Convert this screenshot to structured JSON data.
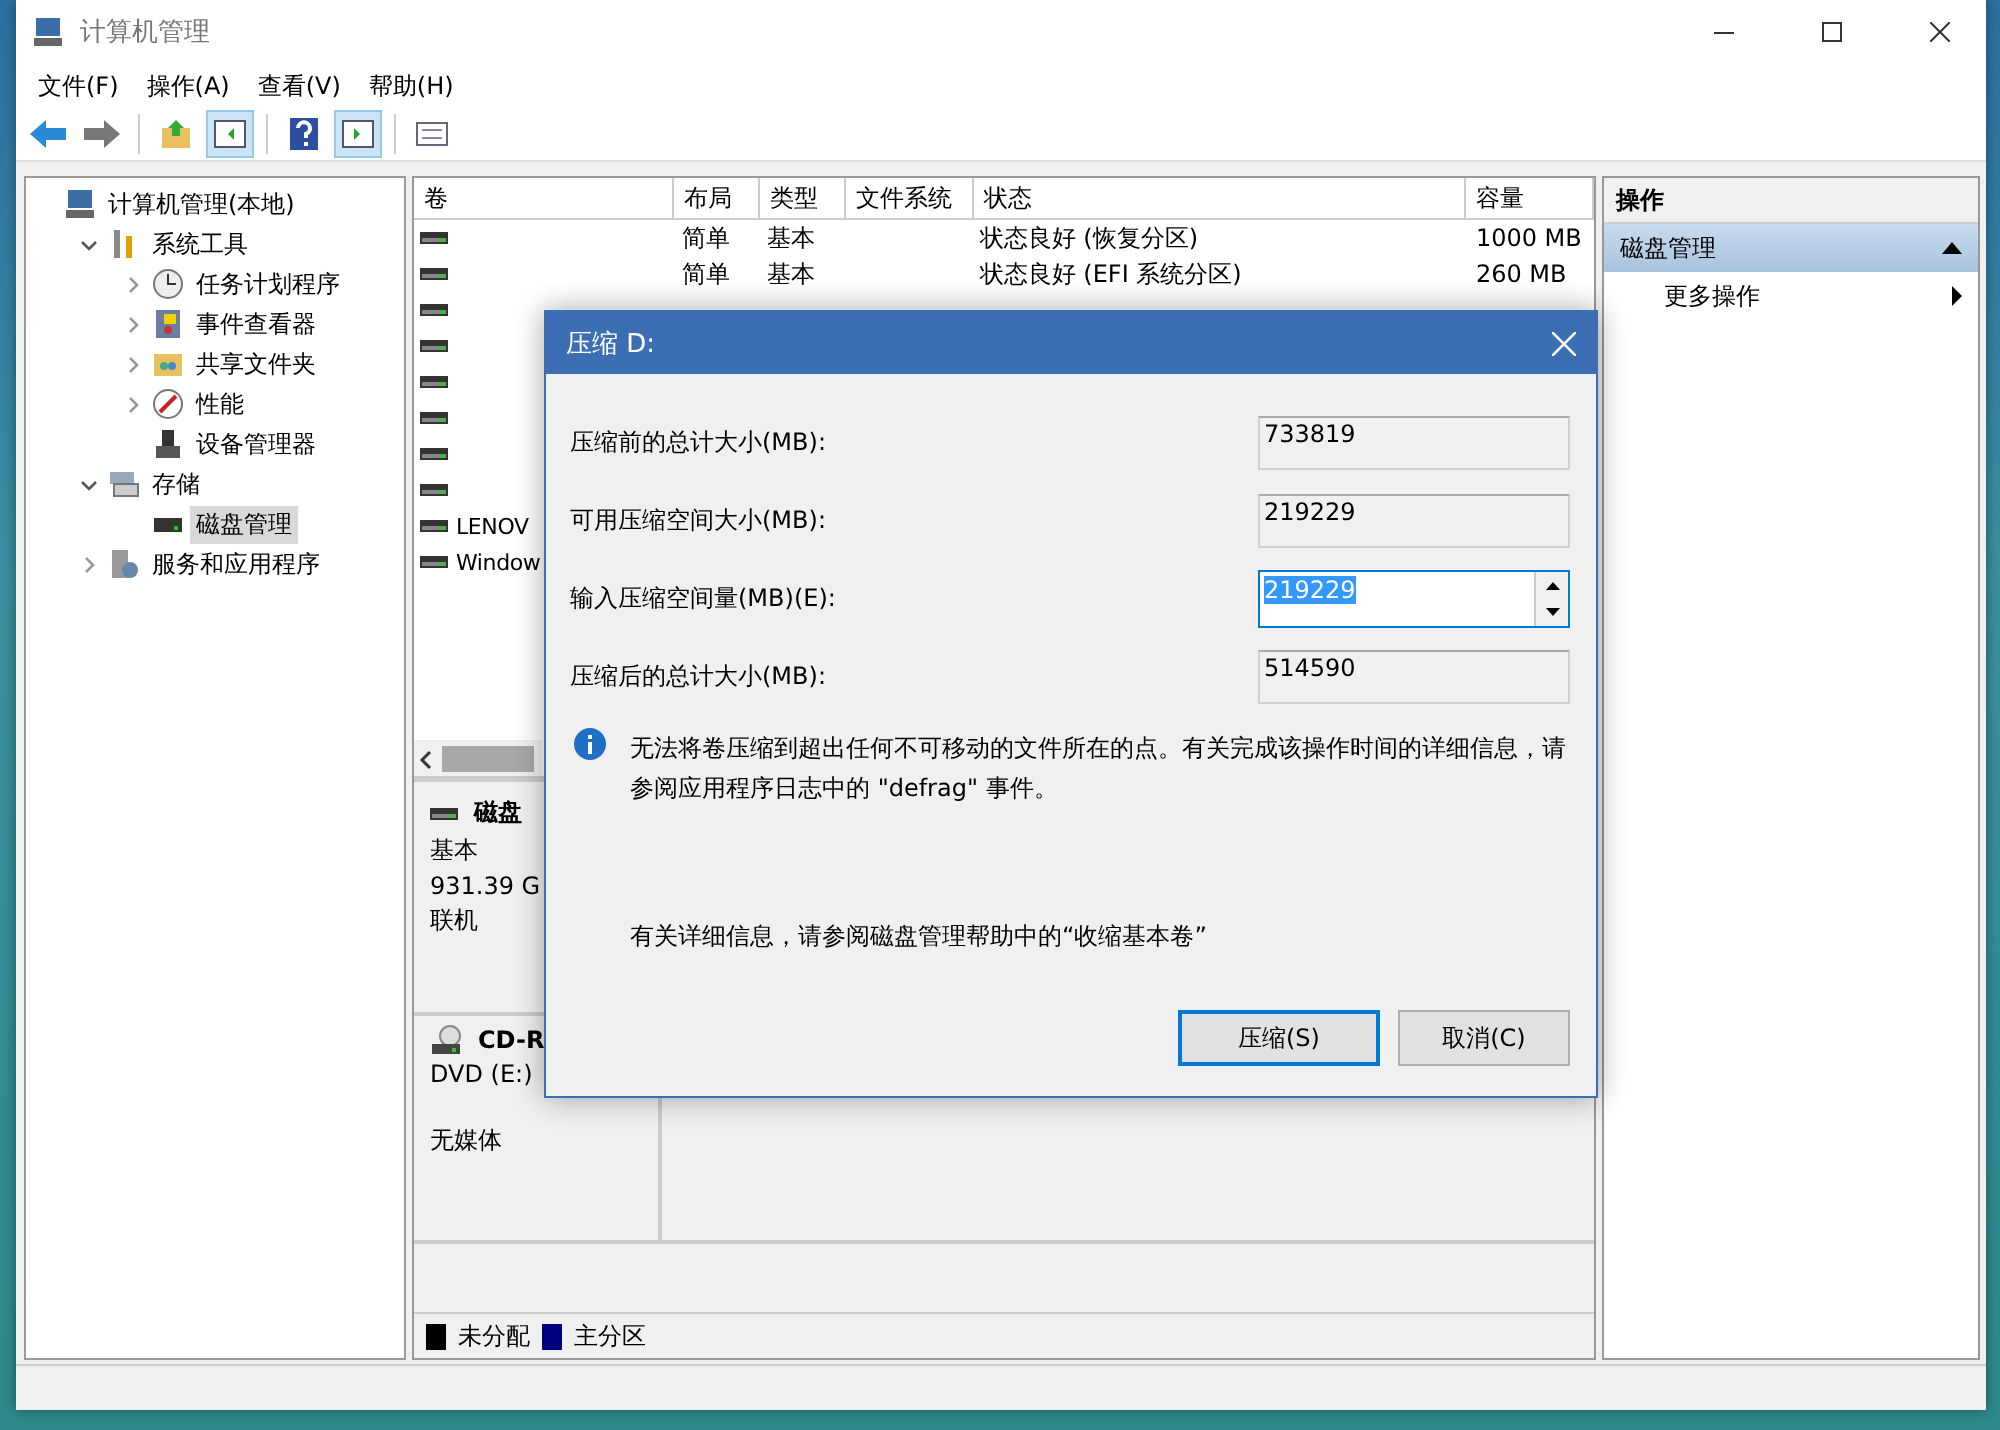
{
  "window": {
    "title": "计算机管理"
  },
  "menu": [
    "文件(F)",
    "操作(A)",
    "查看(V)",
    "帮助(H)"
  ],
  "tree": [
    {
      "label": "计算机管理(本地)",
      "selected": false,
      "children": [
        {
          "label": "系统工具",
          "expanded": true,
          "selected": false,
          "children": [
            {
              "label": "任务计划程序",
              "expanded": false,
              "selected": false
            },
            {
              "label": "事件查看器",
              "expanded": false,
              "selected": false
            },
            {
              "label": "共享文件夹",
              "expanded": false,
              "selected": false
            },
            {
              "label": "性能",
              "expanded": false,
              "selected": false
            },
            {
              "label": "设备管理器",
              "selected": false
            }
          ]
        },
        {
          "label": "存储",
          "expanded": true,
          "selected": false,
          "children": [
            {
              "label": "磁盘管理",
              "selected": true
            }
          ]
        },
        {
          "label": "服务和应用程序",
          "expanded": false,
          "selected": false
        }
      ]
    }
  ],
  "table": {
    "columns": [
      "卷",
      "布局",
      "类型",
      "文件系统",
      "状态",
      "容量"
    ],
    "rows": [
      {
        "layout": "简单",
        "type": "基本",
        "status": "状态良好 (恢复分区)",
        "capacity": "1000 MB"
      },
      {
        "layout": "简单",
        "type": "基本",
        "status": "状态良好 (EFI 系统分区)",
        "capacity": "260 MB"
      },
      {},
      {},
      {},
      {},
      {},
      {},
      {
        "volume": "LENOV"
      },
      {
        "volume": "Window"
      }
    ]
  },
  "disks": [
    {
      "kind": "disk",
      "name": "磁盘",
      "type": "基本",
      "size": "931.39 G",
      "status": "联机"
    },
    {
      "kind": "cdrom",
      "name": "CD-R",
      "type": "DVD (E:)",
      "status": "无媒体"
    }
  ],
  "legend": [
    {
      "label": "未分配",
      "color": "#000000"
    },
    {
      "label": "主分区",
      "color": "#000080"
    }
  ],
  "actions": {
    "title": "操作",
    "section": "磁盘管理",
    "expanded": true,
    "items": [
      "更多操作"
    ]
  },
  "dialog": {
    "title": "压缩 D:",
    "fields": [
      {
        "kind": "readonly",
        "label": "压缩前的总计大小(MB):",
        "value": "733819"
      },
      {
        "kind": "readonly",
        "label": "可用压缩空间大小(MB):",
        "value": "219229"
      },
      {
        "kind": "spin",
        "label": "输入压缩空间量(MB)(E):",
        "value": "219229",
        "text_selected": true
      },
      {
        "kind": "readonly",
        "label": "压缩后的总计大小(MB):",
        "value": "514590"
      }
    ],
    "info": "无法将卷压缩到超出任何不可移动的文件所在的点。有关完成该操作时间的详细信息，请参阅应用程序日志中的 \"defrag\" 事件。",
    "help": "有关详细信息，请参阅磁盘管理帮助中的“收缩基本卷”",
    "buttons": [
      {
        "label": "压缩(S)",
        "default": true
      },
      {
        "label": "取消(C)",
        "default": false
      }
    ]
  }
}
